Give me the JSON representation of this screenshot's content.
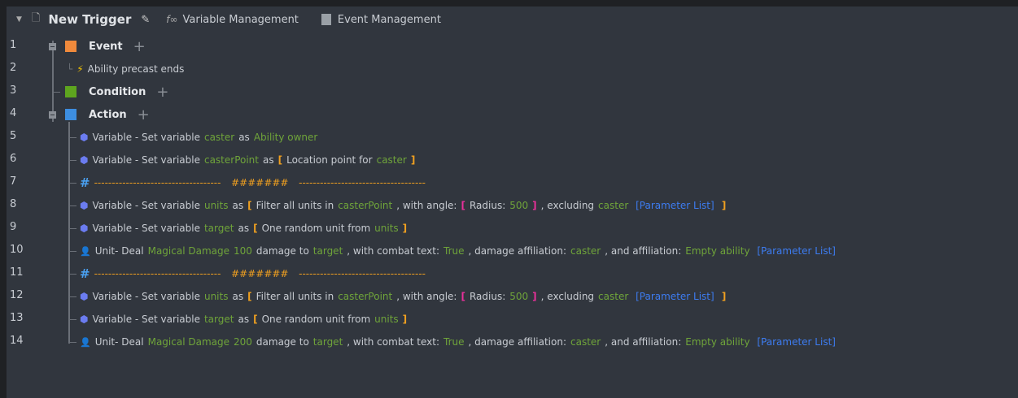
{
  "header": {
    "title": "New Trigger",
    "variable_management": "Variable Management",
    "event_management": "Event Management"
  },
  "line_numbers": [
    "1",
    "2",
    "3",
    "4",
    "5",
    "6",
    "7",
    "8",
    "9",
    "10",
    "11",
    "12",
    "13",
    "14"
  ],
  "sections": {
    "event": "Event",
    "condition": "Condition",
    "action": "Action"
  },
  "event_item": "Ability precast ends",
  "colors": {
    "text": "#c8ccd2",
    "variable": "#6fa43a",
    "bracket": "#f0a020",
    "inner_bracket": "#e8309a",
    "param_list": "#3d7cf0"
  },
  "actions": [
    {
      "icon": "variable-icon",
      "tokens": [
        {
          "t": "Variable - Set variable",
          "c": "text"
        },
        {
          "t": "caster",
          "c": "var"
        },
        {
          "t": "as",
          "c": "text"
        },
        {
          "t": "Ability owner",
          "c": "var"
        }
      ]
    },
    {
      "icon": "variable-icon",
      "tokens": [
        {
          "t": "Variable - Set variable",
          "c": "text"
        },
        {
          "t": "casterPoint",
          "c": "var"
        },
        {
          "t": "as",
          "c": "text"
        },
        {
          "t": "[",
          "c": "ob"
        },
        {
          "t": "Location point for",
          "c": "text"
        },
        {
          "t": "caster",
          "c": "var"
        },
        {
          "t": "]",
          "c": "ob"
        }
      ]
    },
    {
      "icon": "comment-icon",
      "tokens": [
        {
          "t": "------------------------------------",
          "c": "dash"
        },
        {
          "t": "  #######  ",
          "c": "dash"
        },
        {
          "t": "------------------------------------",
          "c": "dash"
        }
      ]
    },
    {
      "icon": "variable-icon",
      "tokens": [
        {
          "t": "Variable - Set variable",
          "c": "text"
        },
        {
          "t": "units",
          "c": "var"
        },
        {
          "t": "as",
          "c": "text"
        },
        {
          "t": "[",
          "c": "ob"
        },
        {
          "t": "Filter all units in",
          "c": "text"
        },
        {
          "t": "casterPoint",
          "c": "var"
        },
        {
          "t": ", with angle:",
          "c": "text"
        },
        {
          "t": "[",
          "c": "pk"
        },
        {
          "t": "Radius:",
          "c": "text"
        },
        {
          "t": "500",
          "c": "var"
        },
        {
          "t": "]",
          "c": "pk"
        },
        {
          "t": ", excluding",
          "c": "text"
        },
        {
          "t": "caster",
          "c": "var"
        },
        {
          "t": " [Parameter List]",
          "c": "bl"
        },
        {
          "t": " ]",
          "c": "ob"
        }
      ]
    },
    {
      "icon": "variable-icon",
      "tokens": [
        {
          "t": "Variable - Set variable",
          "c": "text"
        },
        {
          "t": "target",
          "c": "var"
        },
        {
          "t": "as",
          "c": "text"
        },
        {
          "t": "[",
          "c": "ob"
        },
        {
          "t": "One random unit from",
          "c": "text"
        },
        {
          "t": "units",
          "c": "var"
        },
        {
          "t": "]",
          "c": "ob"
        }
      ]
    },
    {
      "icon": "unit-icon",
      "tokens": [
        {
          "t": "Unit- Deal",
          "c": "text"
        },
        {
          "t": "Magical Damage",
          "c": "var"
        },
        {
          "t": "100",
          "c": "var"
        },
        {
          "t": "damage to",
          "c": "text"
        },
        {
          "t": "target",
          "c": "var"
        },
        {
          "t": ", with combat text:",
          "c": "text"
        },
        {
          "t": "True",
          "c": "var"
        },
        {
          "t": ", damage affiliation:",
          "c": "text"
        },
        {
          "t": "caster",
          "c": "var"
        },
        {
          "t": ", and affiliation:",
          "c": "text"
        },
        {
          "t": "Empty ability",
          "c": "var"
        },
        {
          "t": " [Parameter List]",
          "c": "bl"
        }
      ]
    },
    {
      "icon": "comment-icon",
      "tokens": [
        {
          "t": "------------------------------------",
          "c": "dash"
        },
        {
          "t": "  #######  ",
          "c": "dash"
        },
        {
          "t": "------------------------------------",
          "c": "dash"
        }
      ]
    },
    {
      "icon": "variable-icon",
      "tokens": [
        {
          "t": "Variable - Set variable",
          "c": "text"
        },
        {
          "t": "units",
          "c": "var"
        },
        {
          "t": "as",
          "c": "text"
        },
        {
          "t": "[",
          "c": "ob"
        },
        {
          "t": "Filter all units in",
          "c": "text"
        },
        {
          "t": "casterPoint",
          "c": "var"
        },
        {
          "t": ", with angle:",
          "c": "text"
        },
        {
          "t": "[",
          "c": "pk"
        },
        {
          "t": "Radius:",
          "c": "text"
        },
        {
          "t": "500",
          "c": "var"
        },
        {
          "t": "]",
          "c": "pk"
        },
        {
          "t": ", excluding",
          "c": "text"
        },
        {
          "t": "caster",
          "c": "var"
        },
        {
          "t": " [Parameter List]",
          "c": "bl"
        },
        {
          "t": " ]",
          "c": "ob"
        }
      ]
    },
    {
      "icon": "variable-icon",
      "tokens": [
        {
          "t": "Variable - Set variable",
          "c": "text"
        },
        {
          "t": "target",
          "c": "var"
        },
        {
          "t": "as",
          "c": "text"
        },
        {
          "t": "[",
          "c": "ob"
        },
        {
          "t": "One random unit from",
          "c": "text"
        },
        {
          "t": "units",
          "c": "var"
        },
        {
          "t": "]",
          "c": "ob"
        }
      ]
    },
    {
      "icon": "unit-icon",
      "tokens": [
        {
          "t": "Unit- Deal",
          "c": "text"
        },
        {
          "t": "Magical Damage",
          "c": "var"
        },
        {
          "t": "200",
          "c": "var"
        },
        {
          "t": "damage to",
          "c": "text"
        },
        {
          "t": "target",
          "c": "var"
        },
        {
          "t": ", with combat text:",
          "c": "text"
        },
        {
          "t": "True",
          "c": "var"
        },
        {
          "t": ", damage affiliation:",
          "c": "text"
        },
        {
          "t": "caster",
          "c": "var"
        },
        {
          "t": ", and affiliation:",
          "c": "text"
        },
        {
          "t": "Empty ability",
          "c": "var"
        },
        {
          "t": " [Parameter List]",
          "c": "bl"
        }
      ]
    }
  ]
}
